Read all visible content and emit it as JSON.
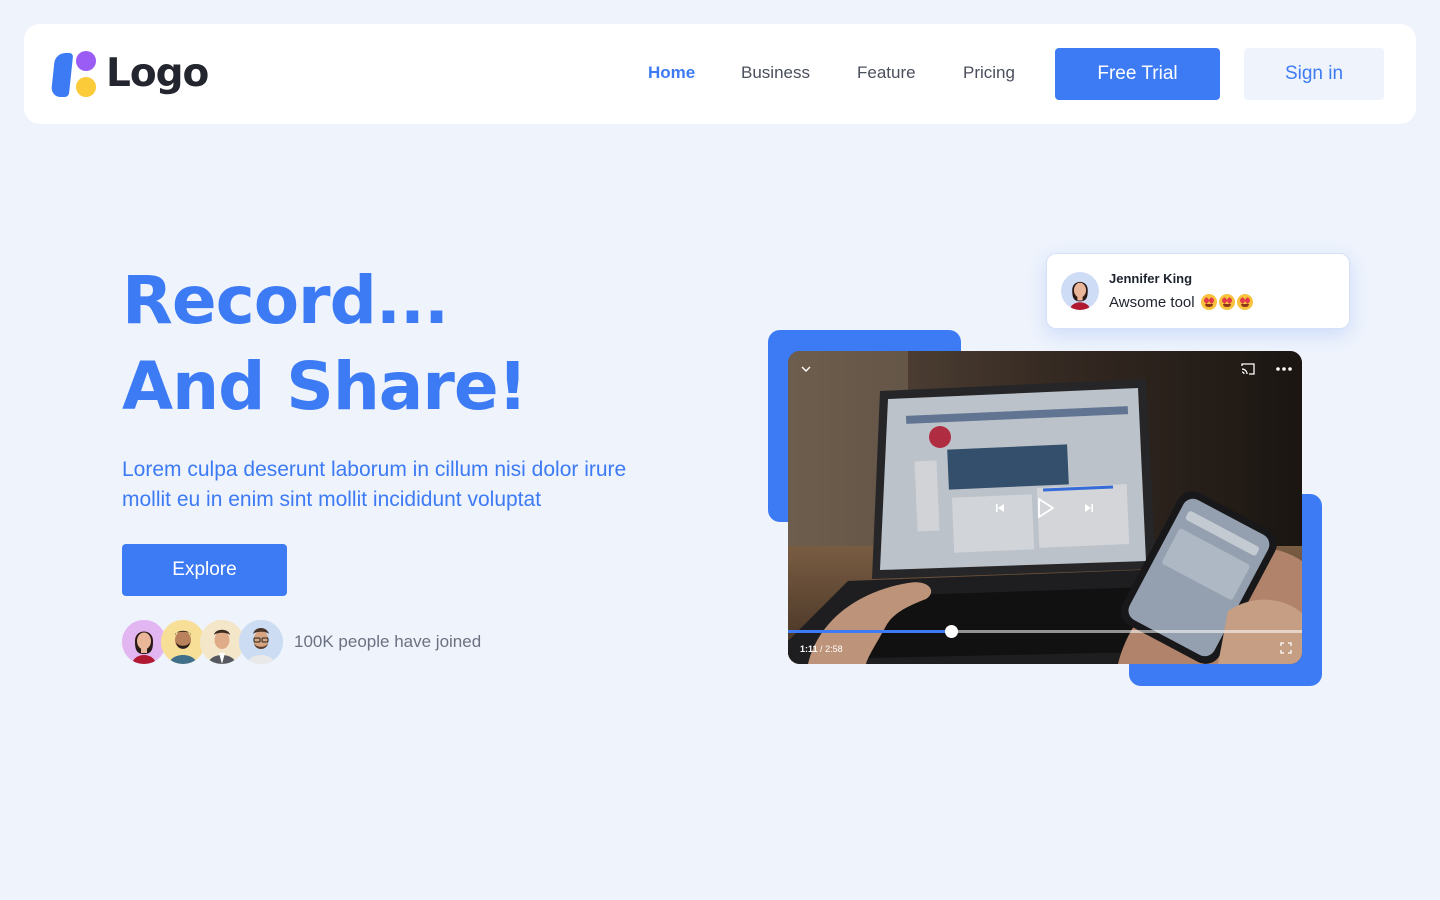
{
  "brand": {
    "logo_text": "Logo"
  },
  "nav": {
    "links": [
      {
        "label": "Home",
        "active": true
      },
      {
        "label": "Business",
        "active": false
      },
      {
        "label": "Feature",
        "active": false
      },
      {
        "label": "Pricing",
        "active": false
      }
    ],
    "free_trial_label": "Free Trial",
    "sign_in_label": "Sign in"
  },
  "hero": {
    "title_line1": "Record...",
    "title_line2": "And Share!",
    "description": "Lorem culpa deserunt laborum in cillum nisi dolor irure mollit eu in enim sint mollit incididunt voluptat",
    "explore_label": "Explore",
    "joined_text": "100K people have joined"
  },
  "comment": {
    "name": "Jennifer King",
    "text": "Awsome tool",
    "emoji_count": 3
  },
  "video": {
    "current_time": "1:11",
    "duration": "2:58",
    "progress_fraction": 0.317
  },
  "colors": {
    "accent": "#3d7bf5",
    "background": "#eef3fc",
    "logo_purple": "#9a5cf5",
    "logo_yellow": "#fbcb3a"
  },
  "icons": {
    "video_top_left": "chevron-down-icon",
    "video_top_right": [
      "cast-icon",
      "more-icon"
    ],
    "video_center": [
      "skip-previous-icon",
      "play-icon",
      "skip-next-icon"
    ],
    "video_bottom_right": "fullscreen-icon"
  }
}
